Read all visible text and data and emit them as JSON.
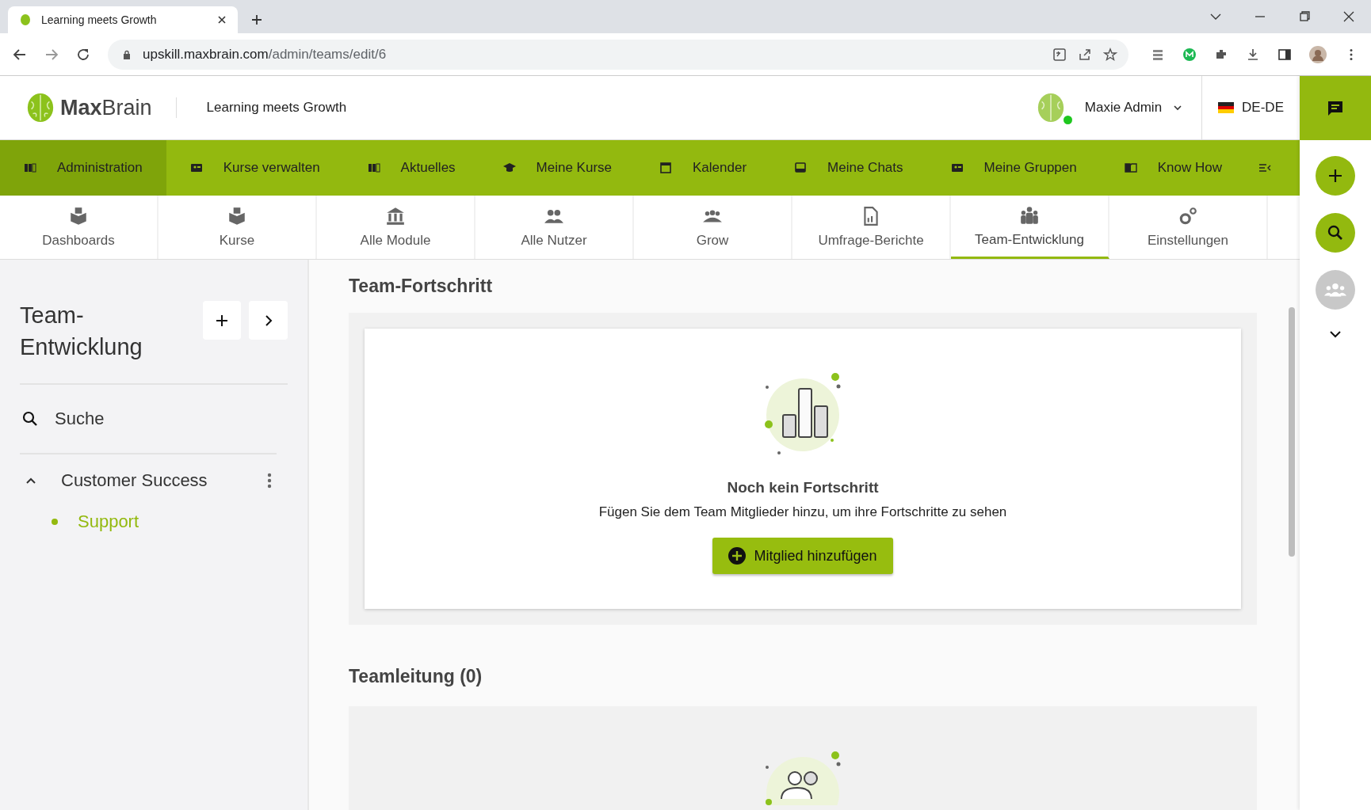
{
  "browser": {
    "tab_title": "Learning meets Growth",
    "url_host": "upskill.maxbrain.com",
    "url_path": "/admin/teams/edit/6"
  },
  "header": {
    "logo_bold": "Max",
    "logo_light": "Brain",
    "tagline": "Learning meets Growth",
    "user": "Maxie Admin",
    "online": true,
    "language": "DE-DE"
  },
  "main_nav": [
    {
      "label": "Administration",
      "selected": true
    },
    {
      "label": "Kurse verwalten",
      "selected": false
    },
    {
      "label": "Aktuelles",
      "selected": false
    },
    {
      "label": "Meine Kurse",
      "selected": false
    },
    {
      "label": "Kalender",
      "selected": false
    },
    {
      "label": "Meine Chats",
      "selected": false
    },
    {
      "label": "Meine Gruppen",
      "selected": false
    },
    {
      "label": "Know How",
      "selected": false
    }
  ],
  "sub_tabs": [
    {
      "label": "Dashboards",
      "selected": false
    },
    {
      "label": "Kurse",
      "selected": false
    },
    {
      "label": "Alle Module",
      "selected": false
    },
    {
      "label": "Alle Nutzer",
      "selected": false
    },
    {
      "label": "Grow",
      "selected": false
    },
    {
      "label": "Umfrage-Berichte",
      "selected": false
    },
    {
      "label": "Team-Entwicklung",
      "selected": true
    },
    {
      "label": "Einstellungen",
      "selected": false
    }
  ],
  "sidebar": {
    "title": "Team-Entwicklung",
    "search": "Suche",
    "items": [
      {
        "label": "Customer Success",
        "expanded": true,
        "children": [
          {
            "label": "Support",
            "selected": true
          }
        ]
      }
    ]
  },
  "progress": {
    "heading": "Team-Fortschritt",
    "empty_title": "Noch kein Fortschritt",
    "empty_text": "Fügen Sie dem Team Mitglieder hinzu, um ihre Fortschritte zu sehen",
    "button": "Mitglied hinzufügen"
  },
  "lead": {
    "heading": "Teamleitung (0)"
  }
}
